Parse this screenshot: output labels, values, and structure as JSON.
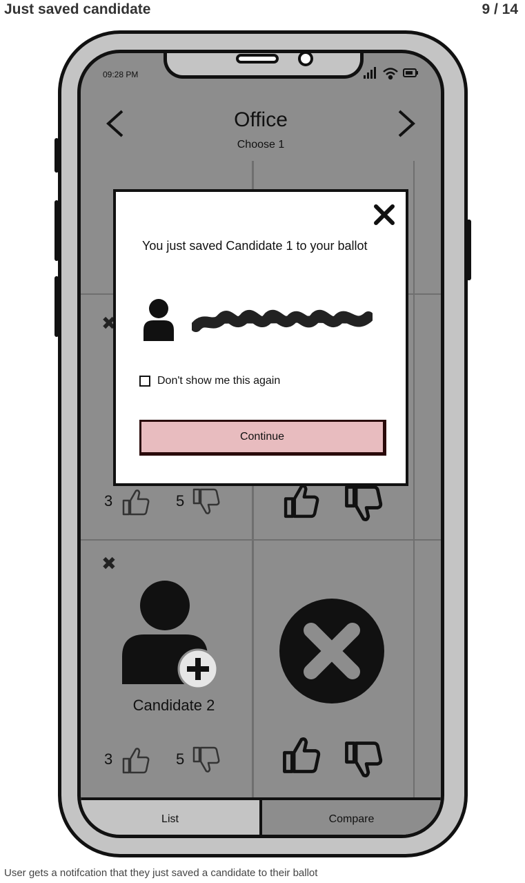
{
  "header": {
    "title": "Just saved candidate",
    "counter": "9 / 14"
  },
  "caption": "User gets a notifcation that they just saved a candidate to their ballot",
  "status": {
    "time": "09:28 PM"
  },
  "nav": {
    "title": "Office",
    "subtitle": "Choose 1"
  },
  "cards": {
    "row1_left": {
      "up_count": "3",
      "down_count": "5"
    },
    "row2_left": {
      "name": "Candidate 2",
      "up_count": "3",
      "down_count": "5"
    }
  },
  "tabs": {
    "list": "List",
    "compare": "Compare"
  },
  "modal": {
    "message": "You just saved Candidate 1 to your ballot",
    "checkbox_label": "Don't show me this again",
    "continue_label": "Continue"
  },
  "colors": {
    "screen": "#8d8d8d",
    "button": "#e8bcbf",
    "shell": "#c4c4c4"
  }
}
